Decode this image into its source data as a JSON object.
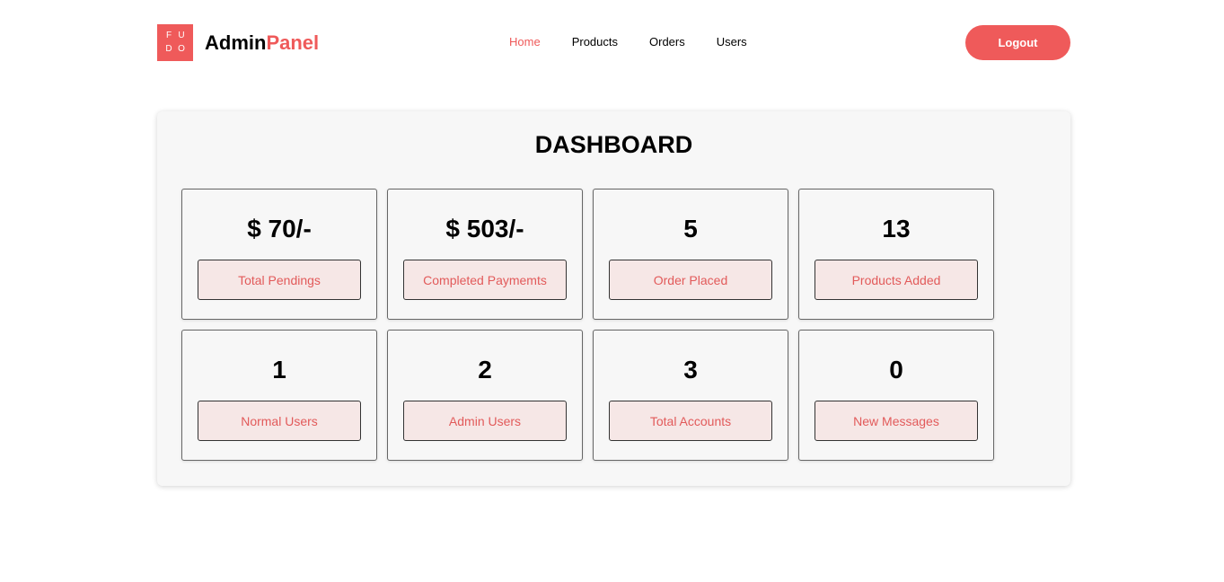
{
  "header": {
    "logo_letters": [
      "F",
      "U",
      "D",
      "O"
    ],
    "brand_primary": "Admin",
    "brand_accent": "Panel",
    "nav": [
      "Home",
      "Products",
      "Orders",
      "Users"
    ],
    "active_nav": "Home",
    "logout_label": "Logout"
  },
  "dashboard": {
    "title": "DASHBOARD",
    "cards": [
      {
        "value": "$ 70/-",
        "label": "Total Pendings"
      },
      {
        "value": "$ 503/-",
        "label": "Completed Paymemts"
      },
      {
        "value": "5",
        "label": "Order Placed"
      },
      {
        "value": "13",
        "label": "Products Added"
      },
      {
        "value": "1",
        "label": "Normal Users"
      },
      {
        "value": "2",
        "label": "Admin Users"
      },
      {
        "value": "3",
        "label": "Total Accounts"
      },
      {
        "value": "0",
        "label": "New Messages"
      }
    ]
  },
  "colors": {
    "accent": "#ef5a5a",
    "card_button_bg": "#f6e7e6",
    "panel_bg": "#f7f7f7"
  }
}
